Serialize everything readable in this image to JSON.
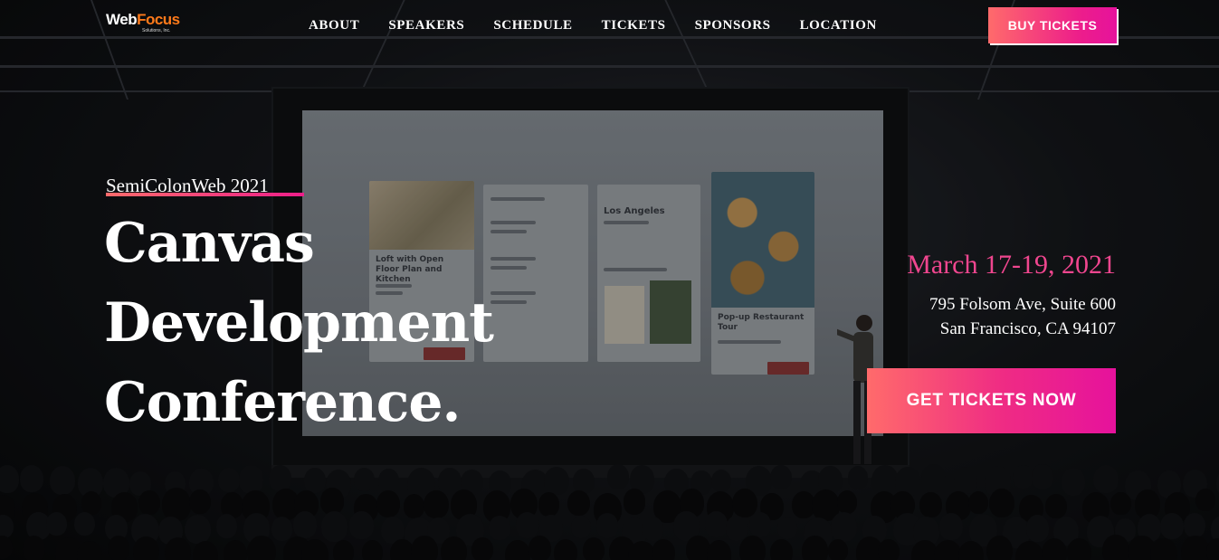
{
  "logo": {
    "text_main": "Web",
    "text_accent": "Focus",
    "subtext": "Solutions, Inc."
  },
  "nav": {
    "items": [
      "ABOUT",
      "SPEAKERS",
      "SCHEDULE",
      "TICKETS",
      "SPONSORS",
      "LOCATION"
    ]
  },
  "header": {
    "buy_label": "BUY TICKETS"
  },
  "hero": {
    "subtitle": "SemiColonWeb 2021",
    "headline": [
      "Canvas",
      "Development",
      "Conference."
    ],
    "date": "March 17-19, 2021",
    "address_line1": "795 Folsom Ave, Suite 600",
    "address_line2": "San Francisco, CA 94107",
    "cta_label": "GET TICKETS NOW"
  },
  "screen_cards": {
    "card1_title": "Loft with Open Floor Plan and Kitchen",
    "card3_title": "Los Angeles",
    "card4_title": "Pop-up Restaurant Tour"
  },
  "colors": {
    "accent_pink": "#ed1e8a",
    "accent_coral": "#ff6b6b",
    "date_pink": "#f0468f",
    "logo_orange": "#ff7a1a"
  }
}
